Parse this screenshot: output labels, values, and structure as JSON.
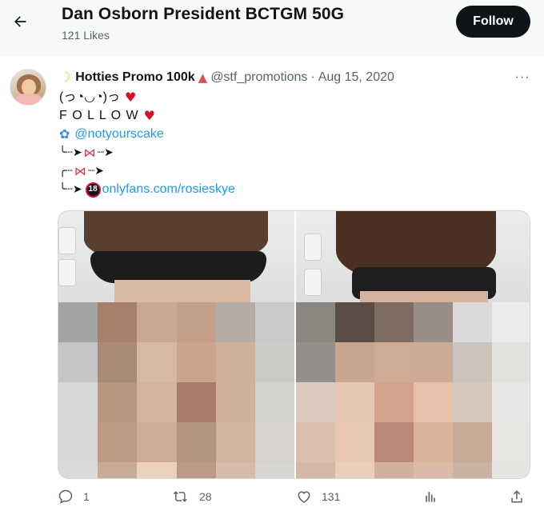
{
  "header": {
    "title": "Dan Osborn President BCTGM 50G",
    "subtitle": "121 Likes",
    "follow_label": "Follow"
  },
  "tweet": {
    "display_name": "Hotties Promo 100k",
    "handle": "@stf_promotions",
    "separator": "·",
    "date": "Aug 15, 2020",
    "more": "···",
    "line1": "(っ◔◡◔)っ",
    "line2": "F O L L O W",
    "mention": "@notyourscake",
    "arrow1": "╰┈➤",
    "arrow2": "╭┈",
    "arrow3": "┈➤",
    "eighteen": "18",
    "link": "onlyfans.com/rosieskye"
  },
  "icons": {
    "moon": "crescent-moon-emoji",
    "party": "party-popper-emoji",
    "heart": "red-heart-emoji",
    "butterfly": "butterfly-emoji",
    "bow": "ribbon-emoji"
  },
  "colors": {
    "accent": "#1d9bf0",
    "text": "#0f1419",
    "muted": "#536471",
    "heart": "#d0102c"
  },
  "actions": {
    "replies": "1",
    "retweets": "28",
    "likes": "131"
  }
}
